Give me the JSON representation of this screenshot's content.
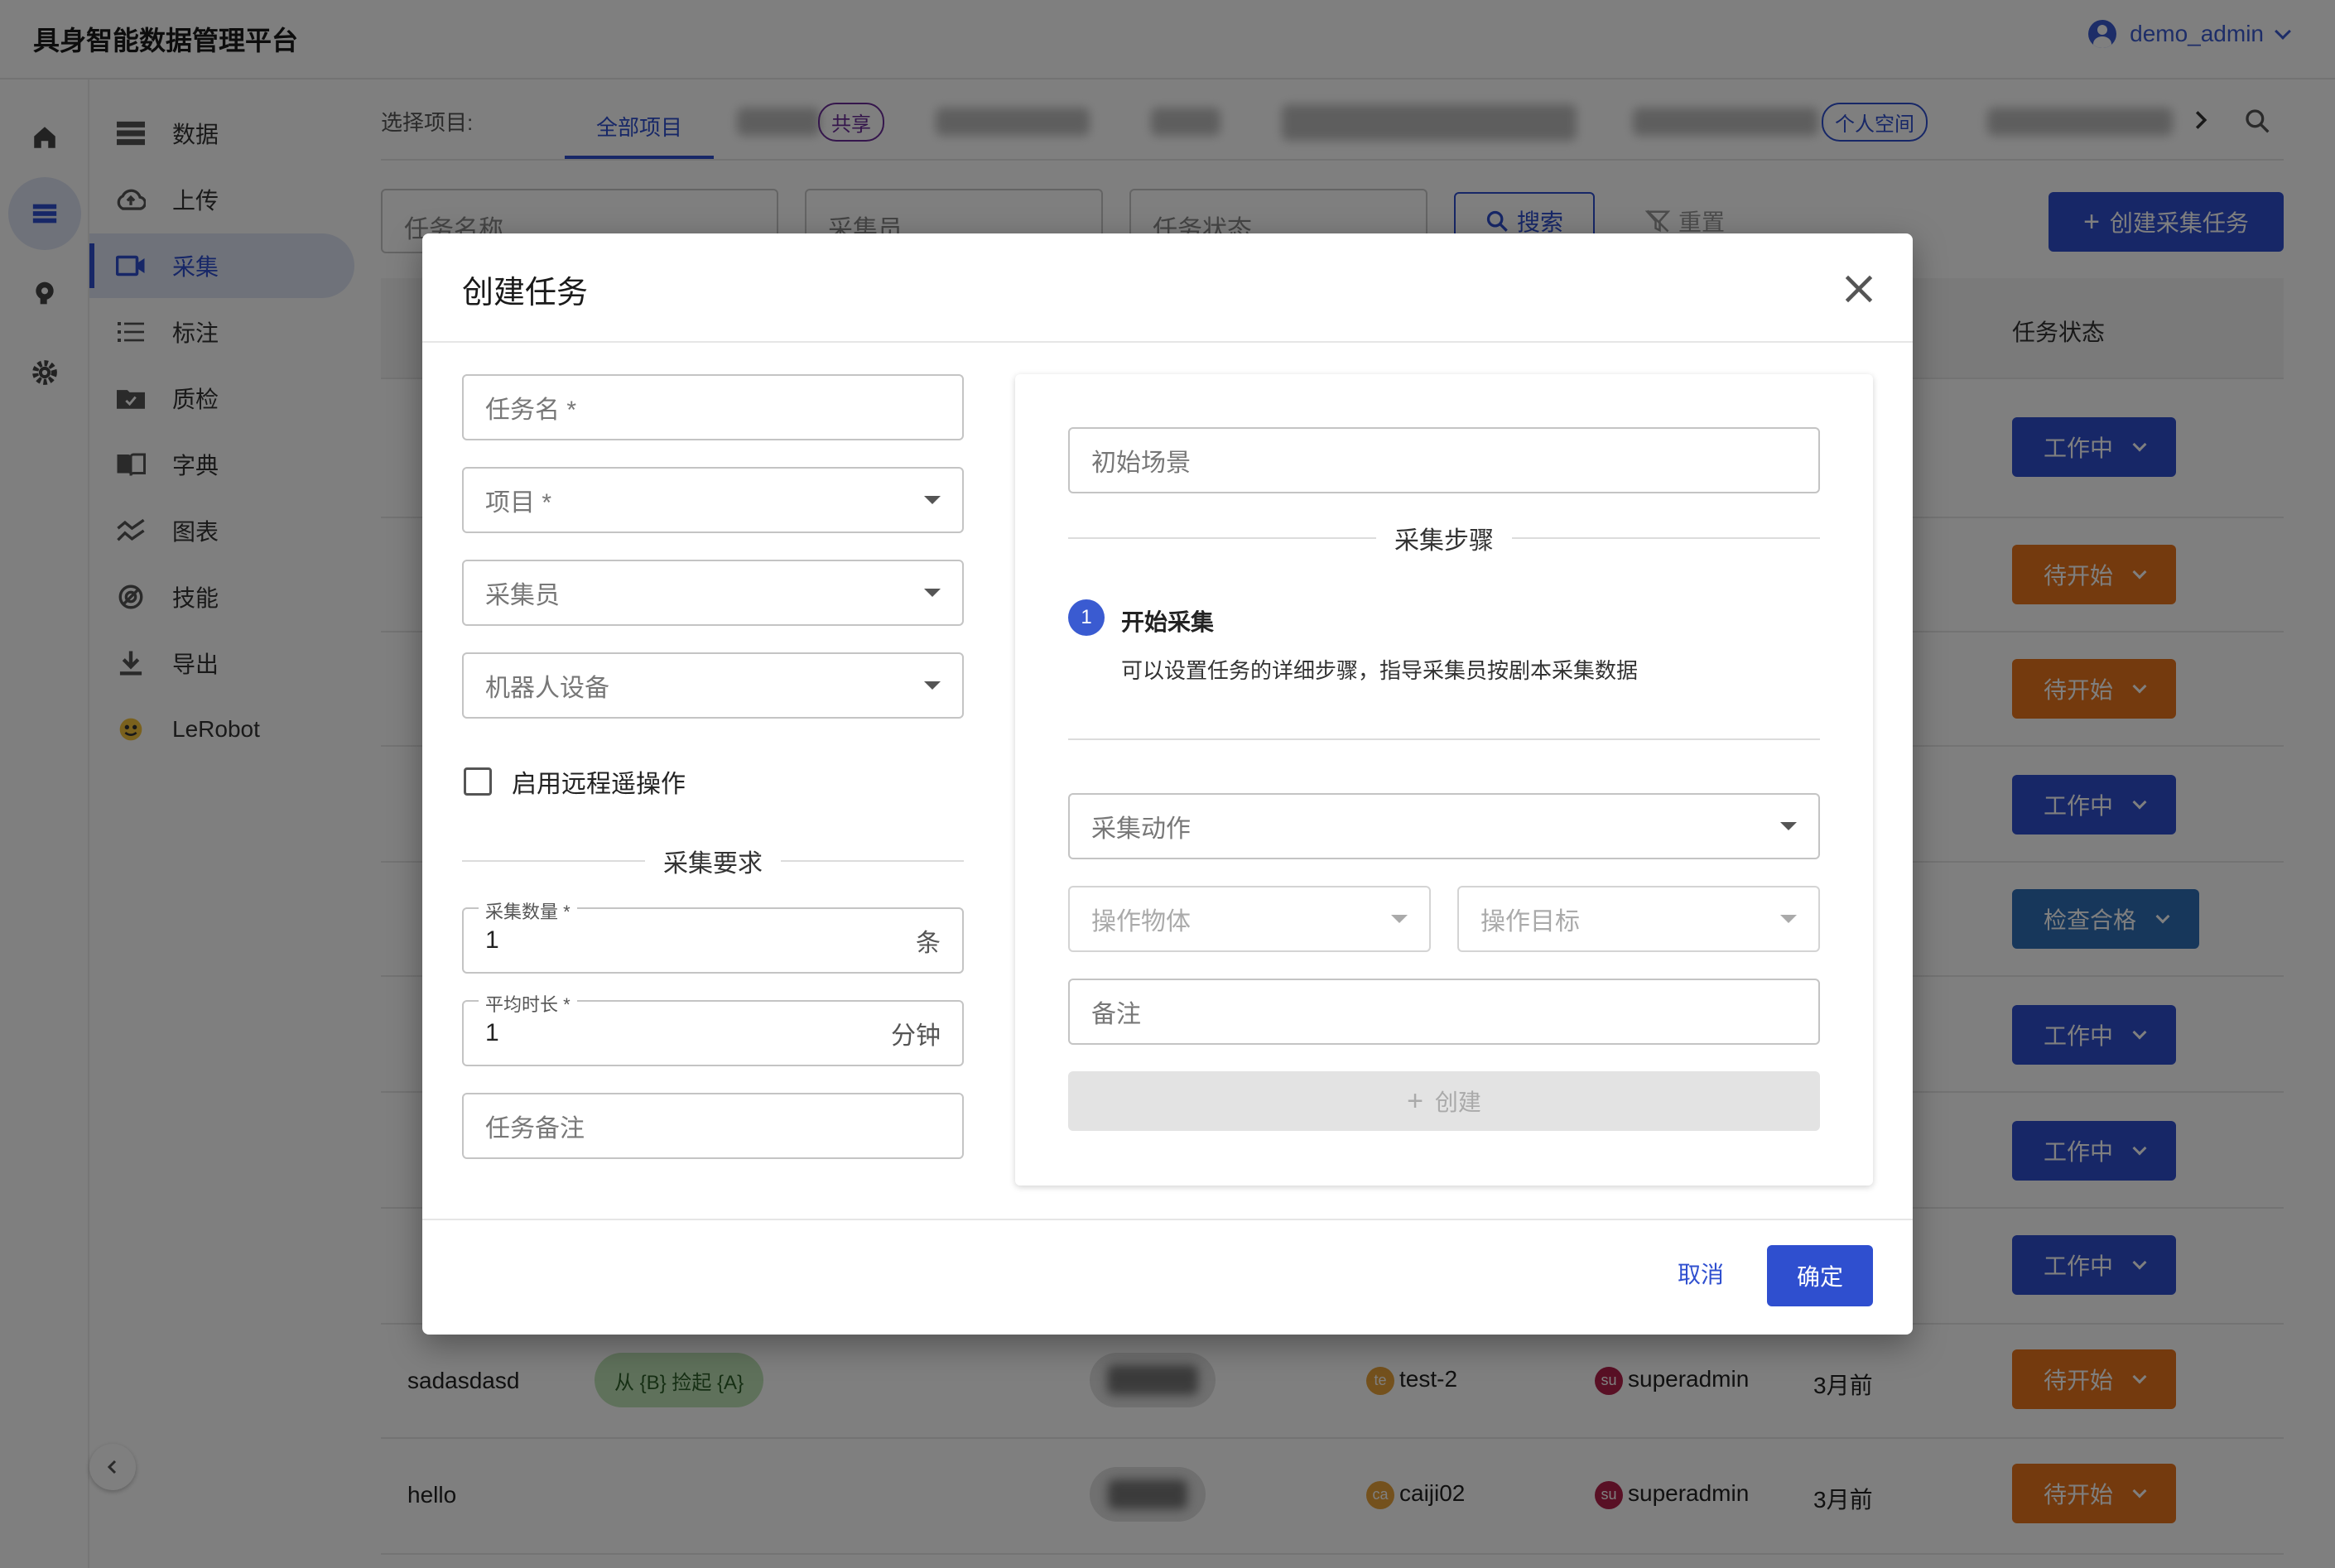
{
  "app": {
    "title": "具身智能数据管理平台",
    "user": "demo_admin"
  },
  "rail": {
    "icons": [
      "home-icon",
      "list-icon",
      "brain-icon",
      "gear-icon"
    ]
  },
  "sidebar": {
    "items": [
      {
        "label": "数据",
        "icon": "storage-icon"
      },
      {
        "label": "上传",
        "icon": "cloud-upload-icon"
      },
      {
        "label": "采集",
        "icon": "video-icon"
      },
      {
        "label": "标注",
        "icon": "list-numbered-icon"
      },
      {
        "label": "质检",
        "icon": "folder-check-icon"
      },
      {
        "label": "字典",
        "icon": "book-icon"
      },
      {
        "label": "图表",
        "icon": "chart-icon"
      },
      {
        "label": "技能",
        "icon": "skill-icon"
      },
      {
        "label": "导出",
        "icon": "download-icon"
      },
      {
        "label": "LeRobot",
        "icon": "robot-emoji-icon"
      }
    ],
    "active_index": 2
  },
  "main": {
    "project_label": "选择项目:",
    "tabs": [
      {
        "label": "全部项目",
        "active": true
      },
      {
        "chip": "共享"
      },
      {
        "chip": "个人空间"
      }
    ],
    "filters": {
      "task_name_placeholder": "任务名称",
      "collector_placeholder": "采集员",
      "status_placeholder": "任务状态",
      "search_label": "搜索",
      "reset_label": "重置",
      "create_label": "创建采集任务"
    },
    "table": {
      "status_header": "任务状态",
      "rows": [
        {
          "status": "工作中",
          "kind": "work"
        },
        {
          "status": "待开始",
          "kind": "wait"
        },
        {
          "status": "待开始",
          "kind": "wait"
        },
        {
          "status": "工作中",
          "kind": "work"
        },
        {
          "status": "检查合格",
          "kind": "ok"
        },
        {
          "status": "工作中",
          "kind": "work"
        },
        {
          "status": "工作中",
          "kind": "work"
        },
        {
          "status": "工作中",
          "kind": "work"
        },
        {
          "name": "sadasdasd",
          "tag": "从 {B} 捡起 {A}",
          "collector_av": "te",
          "collector": "test-2",
          "creator_av": "su",
          "creator": "superadmin",
          "time": "3月前",
          "status": "待开始",
          "kind": "wait"
        },
        {
          "name": "hello",
          "collector_av": "ca",
          "collector": "caiji02",
          "creator_av": "su",
          "creator": "superadmin",
          "time": "3月前",
          "status": "待开始",
          "kind": "wait"
        }
      ]
    }
  },
  "dialog": {
    "title": "创建任务",
    "left": {
      "task_name": "任务名 *",
      "project": "项目 *",
      "collector": "采集员",
      "robot": "机器人设备",
      "remote_label": "启用远程遥操作",
      "requirements_title": "采集要求",
      "count_label": "采集数量 *",
      "count_value": "1",
      "count_unit": "条",
      "duration_label": "平均时长 *",
      "duration_value": "1",
      "duration_unit": "分钟",
      "note": "任务备注"
    },
    "right": {
      "initial_scene": "初始场景",
      "steps_title": "采集步骤",
      "step_number": "1",
      "step_title": "开始采集",
      "step_desc": "可以设置任务的详细步骤，指导采集员按剧本采集数据",
      "action": "采集动作",
      "object": "操作物体",
      "target": "操作目标",
      "remark": "备注",
      "create_label": "创建"
    },
    "cancel_label": "取消",
    "confirm_label": "确定"
  },
  "colors": {
    "primary": "#2f4fcf",
    "wait": "#e8741c",
    "ok": "#2f6fb6"
  }
}
